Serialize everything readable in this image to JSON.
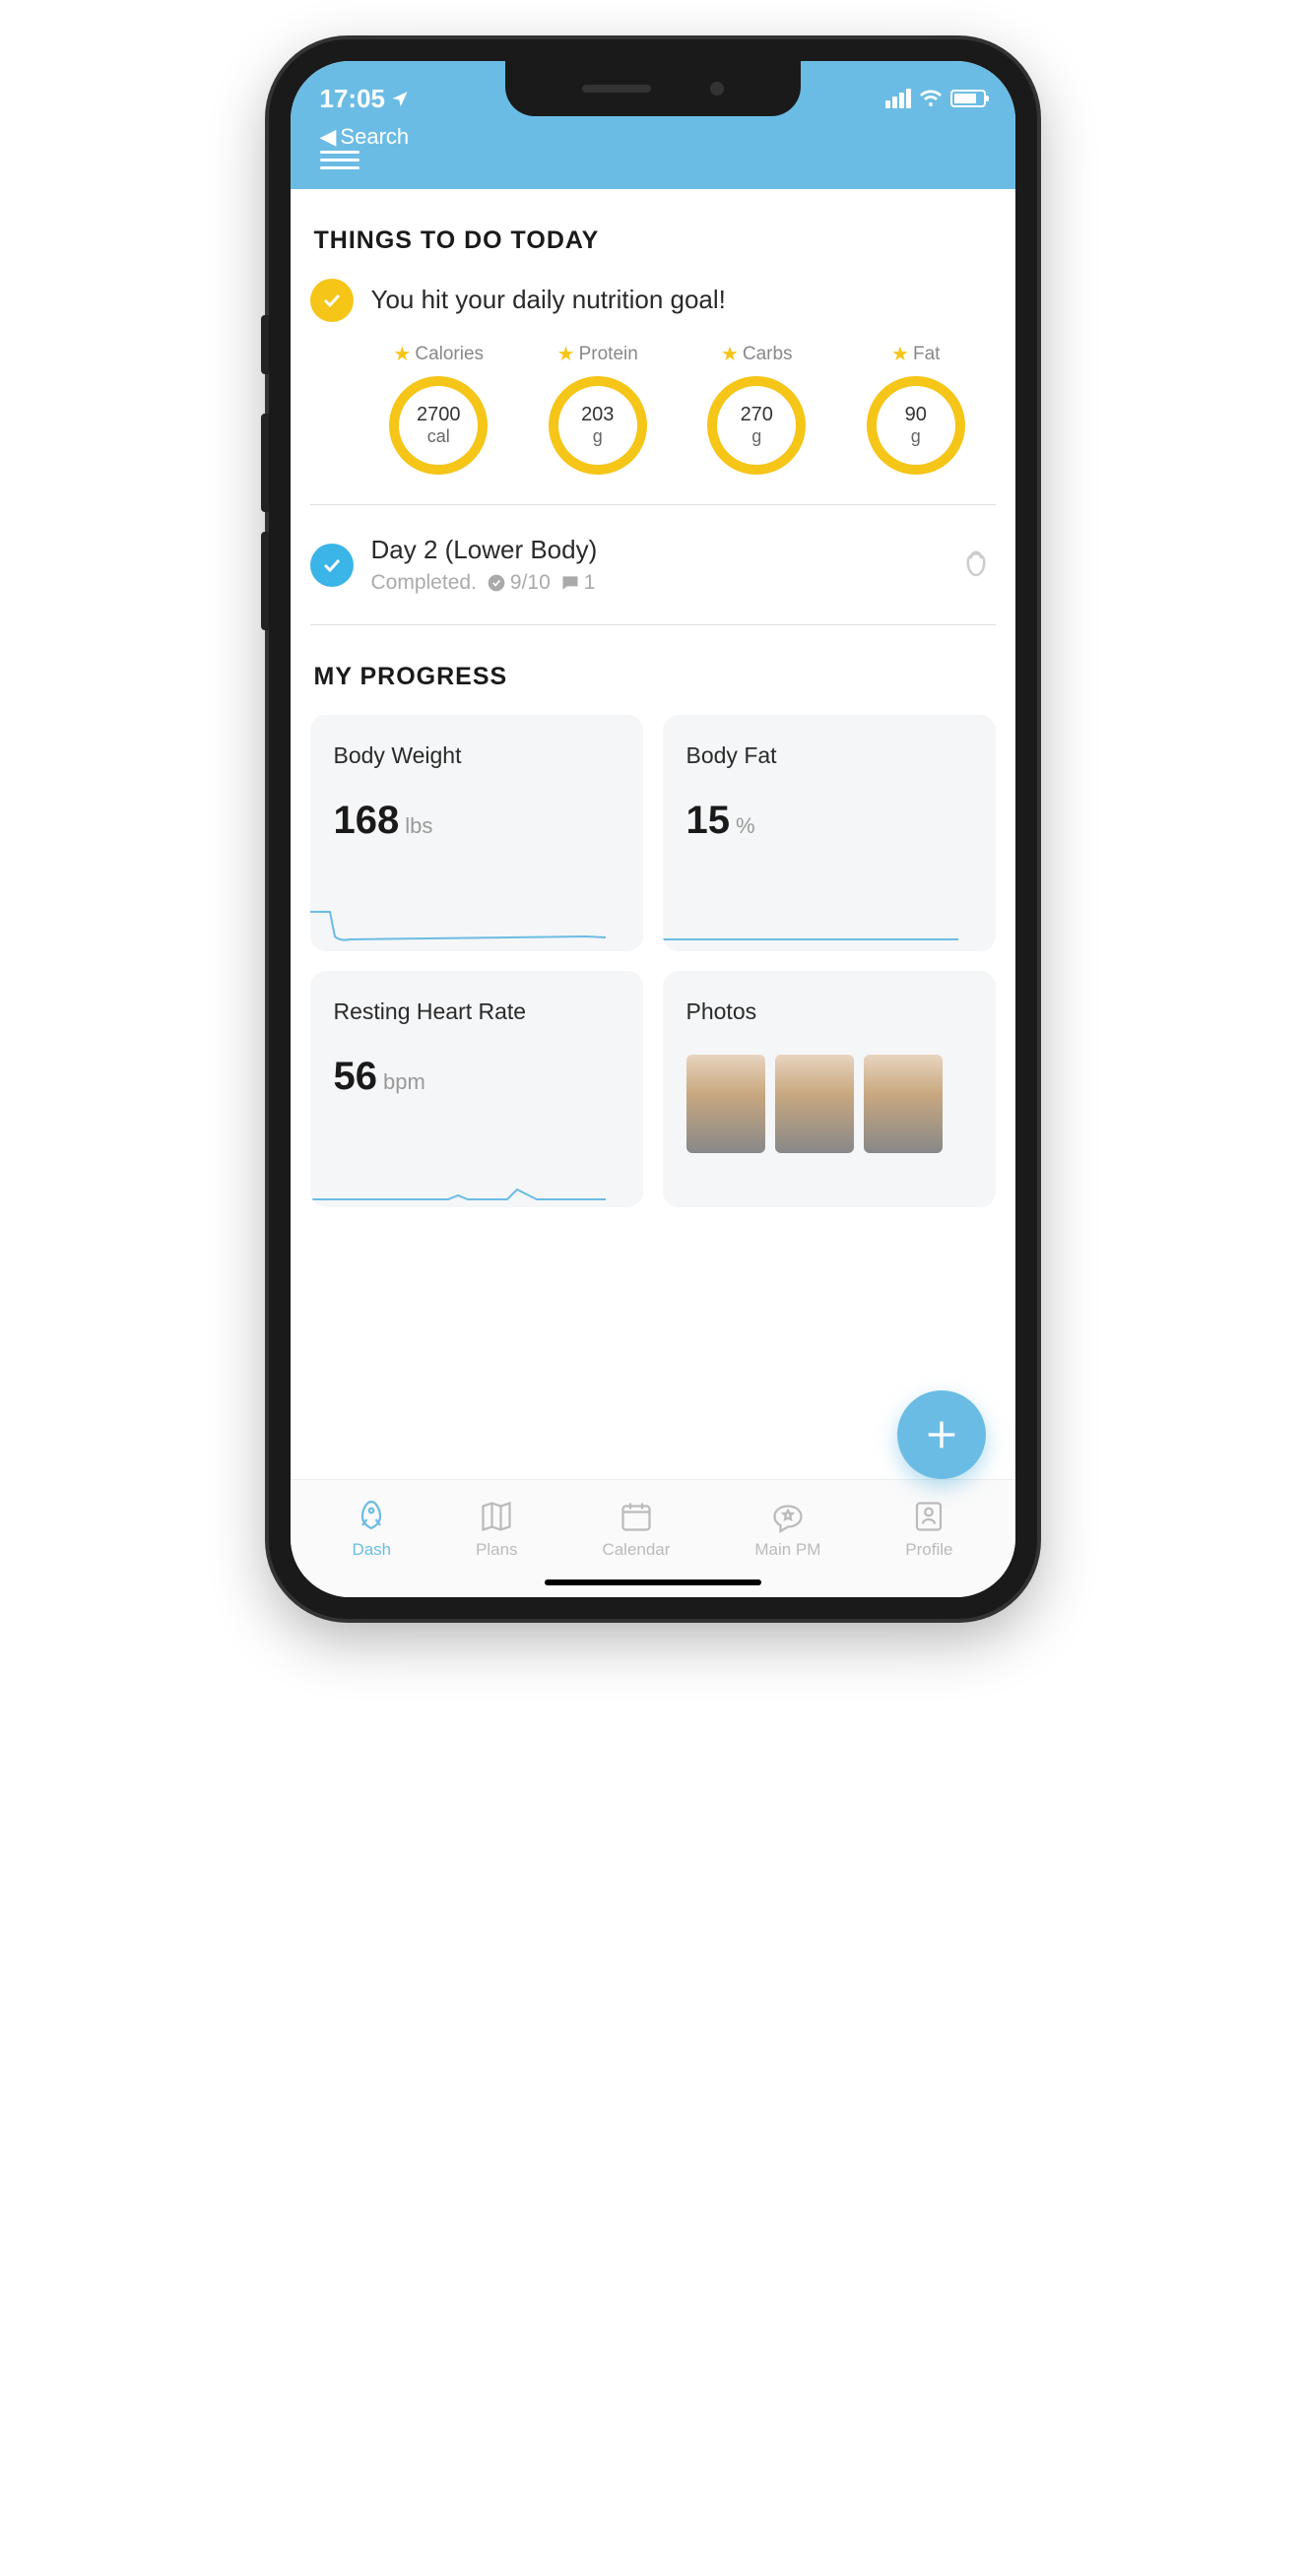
{
  "status": {
    "time": "17:05",
    "back": "Search"
  },
  "sections": {
    "todo_title": "THINGS TO DO TODAY",
    "progress_title": "MY PROGRESS"
  },
  "nutrition": {
    "message": "You hit your daily nutrition goal!",
    "items": [
      {
        "label": "Calories",
        "value": "2700",
        "unit": "cal"
      },
      {
        "label": "Protein",
        "value": "203",
        "unit": "g"
      },
      {
        "label": "Carbs",
        "value": "270",
        "unit": "g"
      },
      {
        "label": "Fat",
        "value": "90",
        "unit": "g"
      }
    ]
  },
  "workout": {
    "title": "Day 2 (Lower Body)",
    "status": "Completed.",
    "rating": "9/10",
    "comments": "1"
  },
  "progress": {
    "cards": [
      {
        "title": "Body Weight",
        "value": "168",
        "unit": "lbs"
      },
      {
        "title": "Body Fat",
        "value": "15",
        "unit": "%"
      },
      {
        "title": "Resting Heart Rate",
        "value": "56",
        "unit": "bpm"
      },
      {
        "title": "Photos",
        "value": "",
        "unit": ""
      }
    ]
  },
  "tabs": [
    {
      "label": "Dash"
    },
    {
      "label": "Plans"
    },
    {
      "label": "Calendar"
    },
    {
      "label": "Main PM"
    },
    {
      "label": "Profile"
    }
  ]
}
